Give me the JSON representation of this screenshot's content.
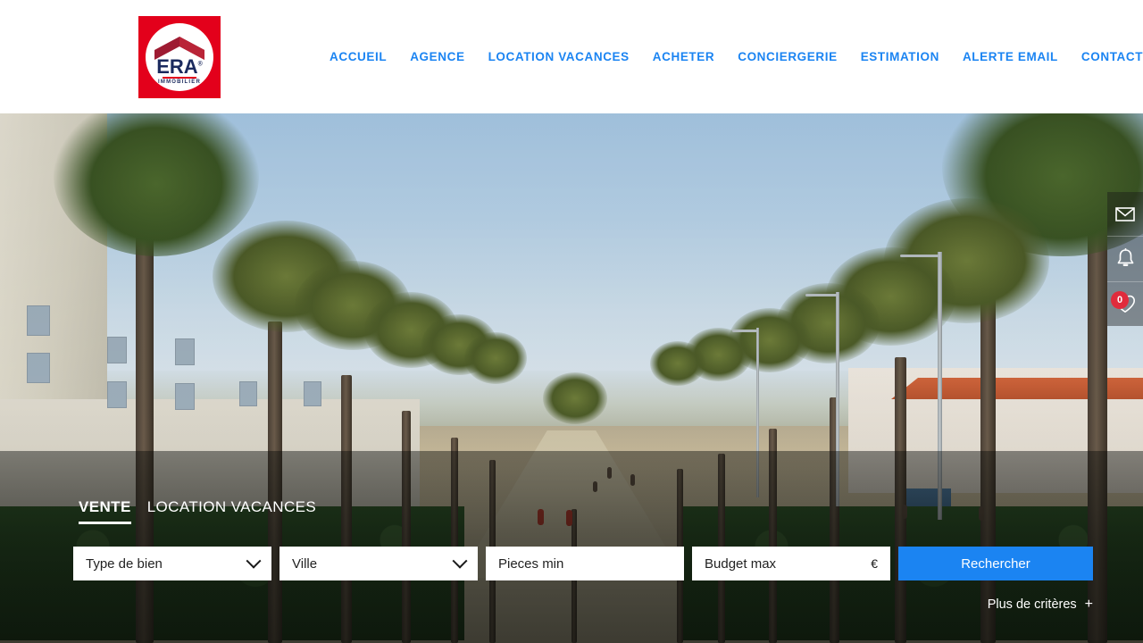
{
  "brand": {
    "name": "ERA",
    "subtitle": "IMMOBILIER",
    "registered": "®",
    "logo_red": "#e3001b",
    "logo_navy": "#1b2a5e"
  },
  "nav": {
    "items": [
      {
        "label": "ACCUEIL"
      },
      {
        "label": "AGENCE"
      },
      {
        "label": "LOCATION VACANCES"
      },
      {
        "label": "ACHETER"
      },
      {
        "label": "CONCIERGERIE"
      },
      {
        "label": "ESTIMATION"
      },
      {
        "label": "ALERTE EMAIL"
      },
      {
        "label": "CONTACT"
      }
    ],
    "link_color": "#1b84f2"
  },
  "rail": {
    "items": [
      {
        "icon": "envelope-icon",
        "name": "mail"
      },
      {
        "icon": "bell-icon",
        "name": "alerts"
      },
      {
        "icon": "heart-icon",
        "name": "favorites"
      }
    ],
    "favorites_count": "0",
    "badge_color": "#e02b3c"
  },
  "search": {
    "tabs": [
      {
        "label": "VENTE",
        "active": true
      },
      {
        "label": "LOCATION VACANCES",
        "active": false
      }
    ],
    "fields": {
      "type_placeholder": "Type de bien",
      "city_placeholder": "Ville",
      "rooms_placeholder": "Pieces min",
      "budget_placeholder": "Budget max",
      "budget_unit": "€"
    },
    "submit_label": "Rechercher",
    "more_label": "Plus de critères",
    "more_plus": "+",
    "accent_color": "#1b84f2"
  }
}
